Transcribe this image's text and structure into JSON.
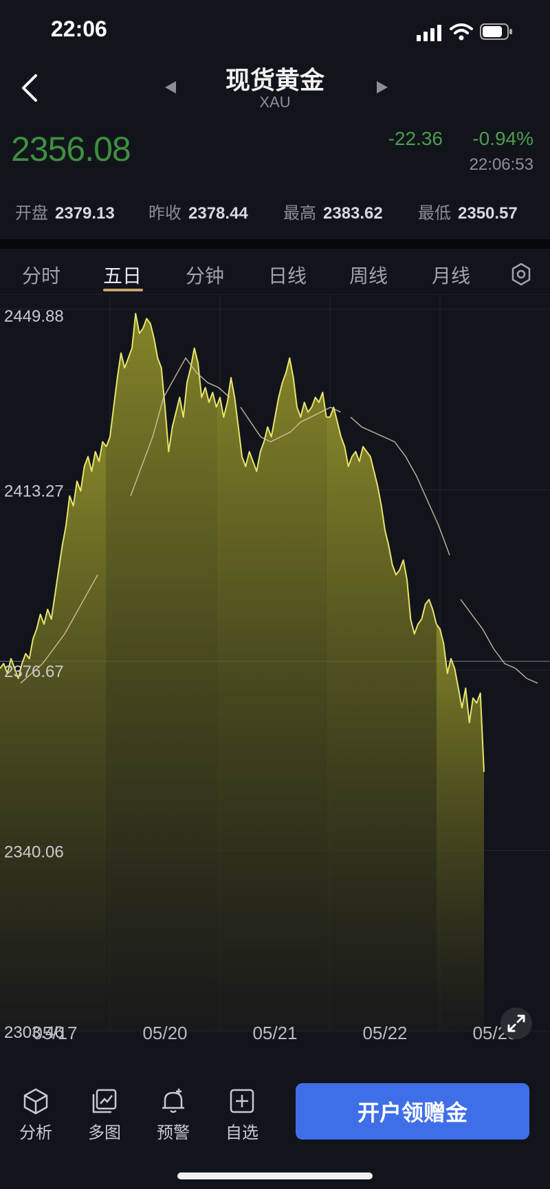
{
  "status_bar": {
    "time": "22:06"
  },
  "header": {
    "title": "现货黄金",
    "symbol": "XAU"
  },
  "quote": {
    "price": "2356.08",
    "change": "-22.36",
    "change_pct": "-0.94%",
    "time": "22:06:53",
    "stats": [
      {
        "label": "开盘",
        "value": "2379.13"
      },
      {
        "label": "昨收",
        "value": "2378.44"
      },
      {
        "label": "最高",
        "value": "2383.62"
      },
      {
        "label": "最低",
        "value": "2350.57"
      }
    ]
  },
  "tabs": [
    "分时",
    "五日",
    "分钟",
    "日线",
    "周线",
    "月线"
  ],
  "active_tab": "五日",
  "chart_data": {
    "type": "area",
    "y_tick_labels": [
      "2449.88",
      "2413.27",
      "2376.67",
      "2340.06",
      "2303.46"
    ],
    "ylim": [
      2303.46,
      2449.88
    ],
    "x_tick_labels": [
      "05/17",
      "05/20",
      "05/21",
      "05/22",
      "05/23"
    ],
    "reference_line": 2378.44,
    "days": [
      {
        "x": "05/17",
        "values": [
          2377,
          2378,
          2376,
          2379,
          2377,
          2375,
          2378,
          2380,
          2379,
          2383,
          2385,
          2388,
          2386,
          2389,
          2387,
          2392,
          2397,
          2402,
          2406,
          2412,
          2410,
          2415,
          2413,
          2418,
          2420,
          2417,
          2421,
          2419,
          2423,
          2422
        ]
      },
      {
        "x": "05/20",
        "values": [
          2424,
          2430,
          2436,
          2441,
          2438,
          2440,
          2442,
          2449,
          2445,
          2446,
          2448,
          2447,
          2444,
          2440,
          2438,
          2430,
          2421,
          2426,
          2429,
          2432,
          2428,
          2435,
          2438,
          2442,
          2439,
          2432,
          2434,
          2431,
          2433,
          2430
        ]
      },
      {
        "x": "05/21",
        "values": [
          2432,
          2428,
          2431,
          2436,
          2432,
          2426,
          2420,
          2418,
          2421,
          2419,
          2417,
          2421,
          2423,
          2426,
          2424,
          2428,
          2432,
          2435,
          2437,
          2440,
          2436,
          2430,
          2428,
          2431,
          2429,
          2430,
          2432,
          2431,
          2433,
          2428
        ]
      },
      {
        "x": "05/22",
        "values": [
          2428,
          2430,
          2427,
          2424,
          2422,
          2418,
          2420,
          2421,
          2419,
          2422,
          2421,
          2420,
          2417,
          2414,
          2410,
          2405,
          2402,
          2398,
          2396,
          2397,
          2399,
          2395,
          2387,
          2384,
          2386,
          2387,
          2390,
          2391,
          2389,
          2386
        ]
      },
      {
        "x": "05/23",
        "values": [
          2385,
          2382,
          2376,
          2379,
          2377,
          2373,
          2369,
          2373,
          2366,
          2371,
          2370,
          2372,
          2356
        ]
      }
    ],
    "moving_average": [
      {
        "x": "05/17",
        "values": [
          2374,
          2376,
          2378,
          2381,
          2384,
          2388,
          2392,
          2396
        ]
      },
      {
        "x": "05/20",
        "values": [
          2412,
          2418,
          2424,
          2432,
          2436,
          2440,
          2437,
          2435,
          2434,
          2432
        ]
      },
      {
        "x": "05/21",
        "values": [
          2430,
          2427,
          2424,
          2423,
          2424,
          2425,
          2427,
          2428,
          2429,
          2430,
          2429
        ]
      },
      {
        "x": "05/22",
        "values": [
          2428,
          2426,
          2425,
          2424,
          2423,
          2420,
          2416,
          2411,
          2406,
          2400
        ]
      },
      {
        "x": "05/23",
        "values": [
          2391,
          2388,
          2385,
          2381,
          2378,
          2377,
          2375,
          2374
        ]
      }
    ],
    "colors": {
      "line": "#e7e56b",
      "fill": "#6b6a22",
      "ma": "#d8c9a8"
    }
  },
  "bottom_nav": [
    {
      "label": "分析",
      "icon": "cube-icon"
    },
    {
      "label": "多图",
      "icon": "multi-chart-icon"
    },
    {
      "label": "预警",
      "icon": "bell-plus-icon"
    },
    {
      "label": "自选",
      "icon": "plus-square-icon"
    }
  ],
  "cta_label": "开户领赠金"
}
